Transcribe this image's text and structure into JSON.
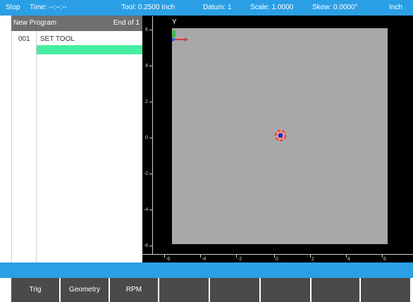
{
  "status_bar": {
    "mode": "Stop",
    "time": "Time:  --:--:--",
    "tool": "Tool: 0.2500 Inch",
    "datum": "Datum: 1",
    "scale": "Scale: 1.0000",
    "skew": "Skew: 0.0000°",
    "units": "Inch"
  },
  "program": {
    "title": "New Program",
    "position": "End of 1",
    "rows": [
      {
        "num": "001",
        "text": "SET TOOL"
      }
    ]
  },
  "graphic": {
    "y_axis_label": "Y",
    "y_ticks": [
      "6",
      "4",
      "2",
      "0",
      "-2",
      "-4",
      "-6"
    ],
    "x_ticks": [
      "-6",
      "-4",
      "-2",
      "0",
      "2",
      "4",
      "6"
    ]
  },
  "softkeys": [
    "Trig",
    "Geometry",
    "RPM",
    "",
    "",
    "",
    "",
    ""
  ],
  "colors": {
    "status_bar": "#2b9fe5",
    "selected_row": "#47eea1",
    "workpiece": "#a8a8a8",
    "softkey": "#4a4a4a"
  }
}
